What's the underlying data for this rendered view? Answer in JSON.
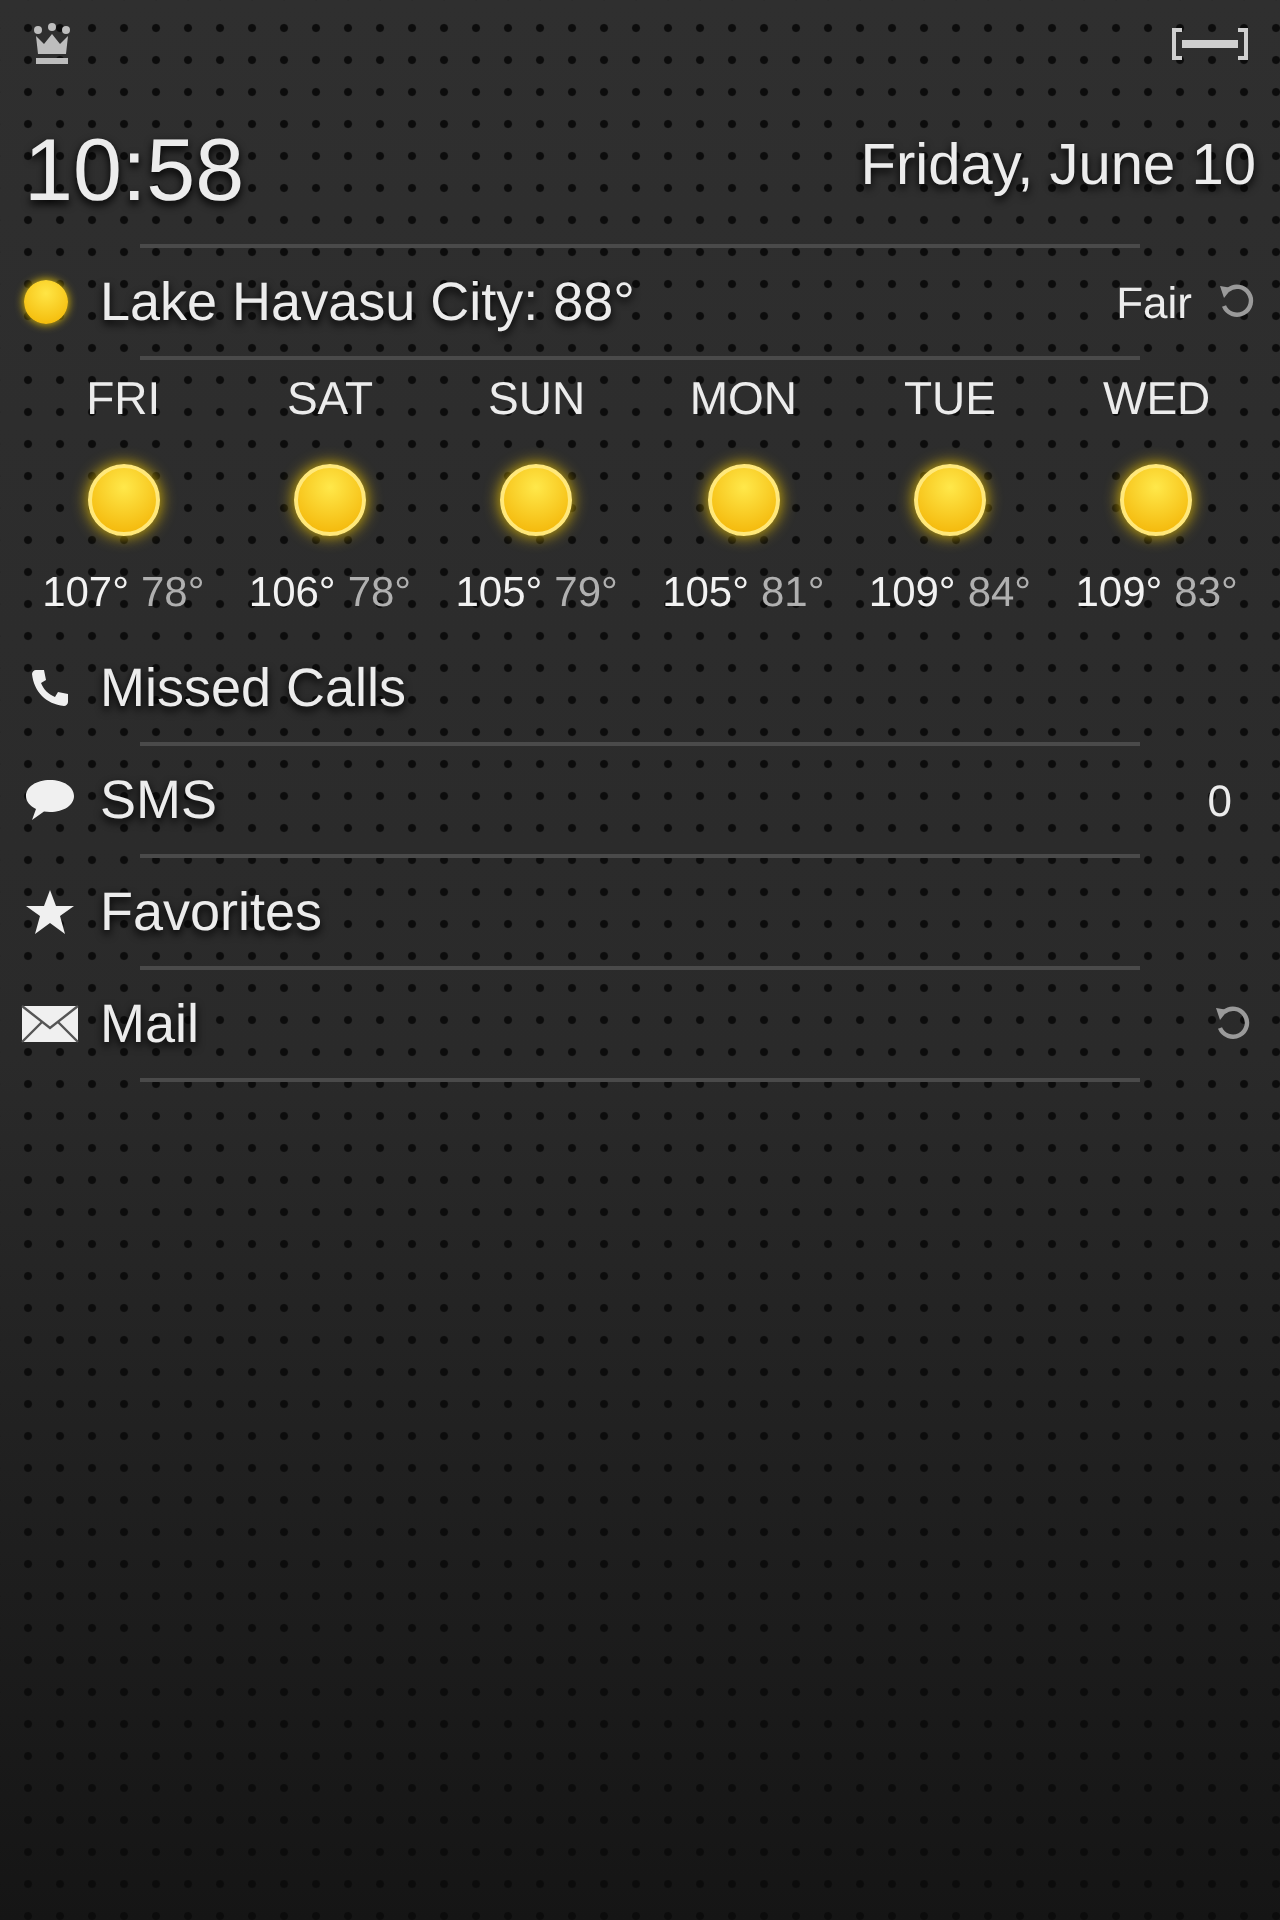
{
  "header": {
    "time": "10:58",
    "date": "Friday, June 10"
  },
  "weather": {
    "location": "Lake Havasu City: 88°",
    "condition": "Fair",
    "refreshable": true
  },
  "forecast": [
    {
      "day": "FRI",
      "high": "107°",
      "low": "78°"
    },
    {
      "day": "SAT",
      "high": "106°",
      "low": "78°"
    },
    {
      "day": "SUN",
      "high": "105°",
      "low": "79°"
    },
    {
      "day": "MON",
      "high": "105°",
      "low": "81°"
    },
    {
      "day": "TUE",
      "high": "109°",
      "low": "84°"
    },
    {
      "day": "WED",
      "high": "109°",
      "low": "83°"
    }
  ],
  "sections": [
    {
      "kind": "calls",
      "label": "Missed Calls",
      "refreshable": false
    },
    {
      "kind": "sms",
      "label": "SMS",
      "count": "0",
      "refreshable": false
    },
    {
      "kind": "favorites",
      "label": "Favorites",
      "refreshable": false
    },
    {
      "kind": "mail",
      "label": "Mail",
      "refreshable": true
    }
  ]
}
